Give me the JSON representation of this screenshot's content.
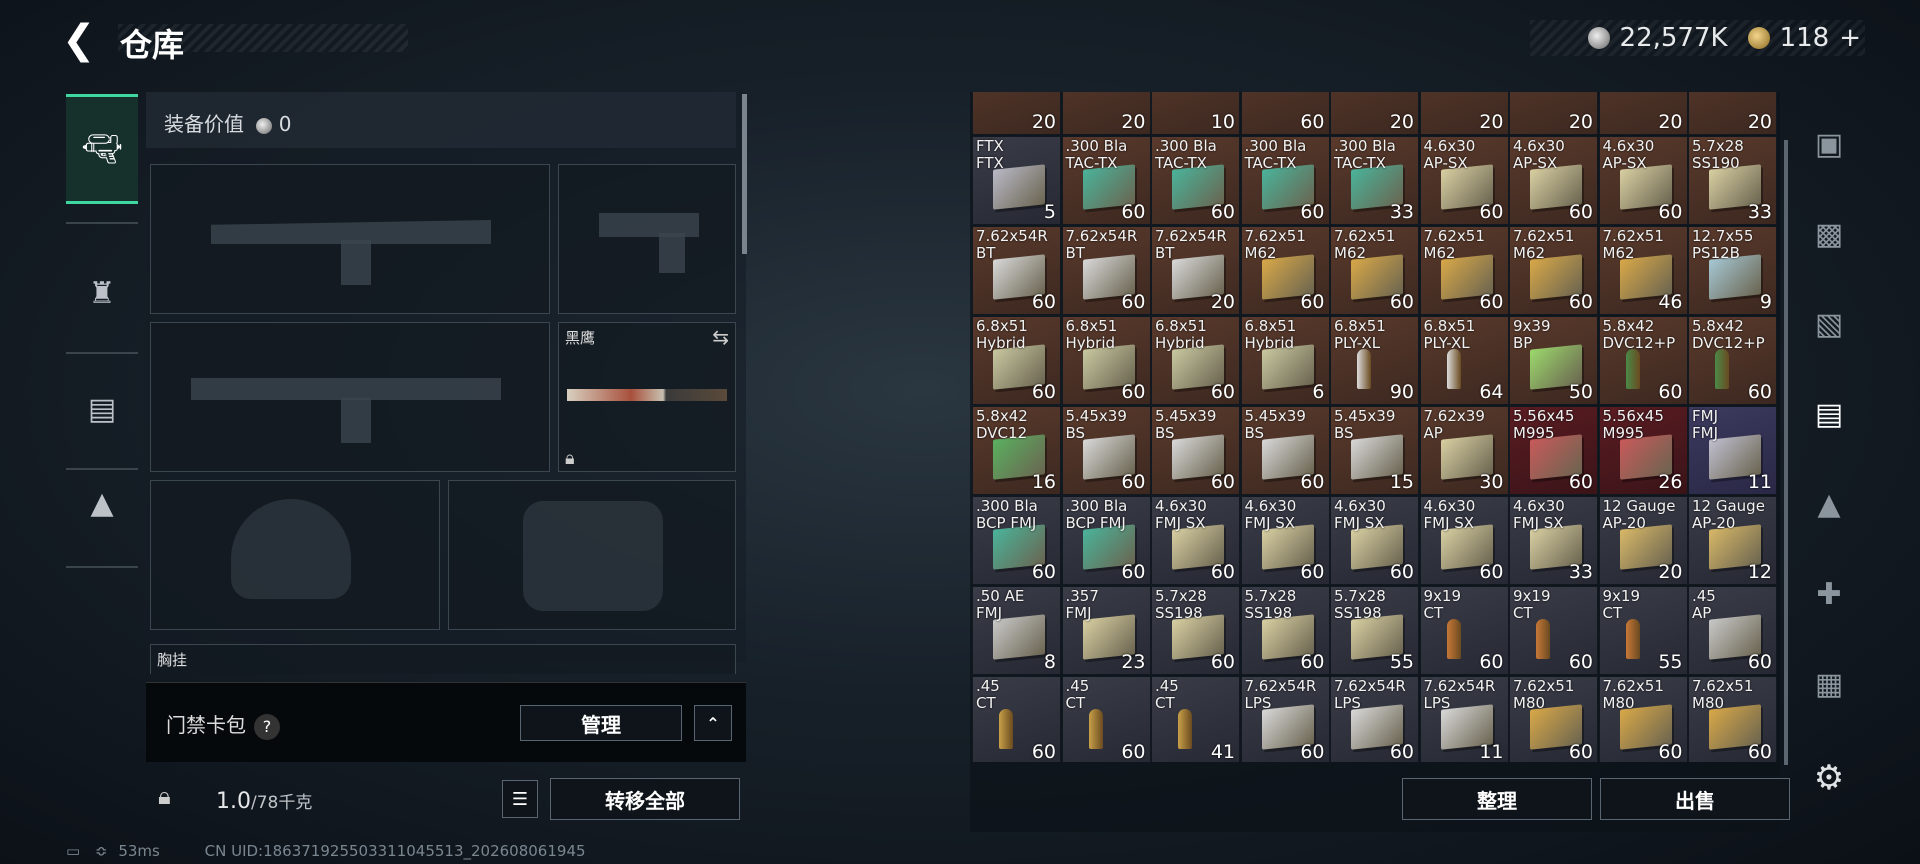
{
  "header": {
    "title": "仓库",
    "silver": "22,577K",
    "gold": "118",
    "plus": "+"
  },
  "left_rail": [
    {
      "icon": "pistol-icon",
      "glyph": "🔫"
    },
    {
      "icon": "backpack-icon",
      "glyph": "⛯"
    },
    {
      "icon": "container-icon",
      "glyph": "▤"
    },
    {
      "icon": "toolbox-icon",
      "glyph": "💼"
    }
  ],
  "equipment": {
    "value_label": "装备价值",
    "value": "0",
    "knife_label": "黑鹰",
    "chest_label": "胸挂"
  },
  "card_pack": {
    "label": "门禁卡包",
    "help": "?",
    "manage": "管理"
  },
  "weight": {
    "current": "1.0",
    "max": "/78千克",
    "transfer_all": "转移全部"
  },
  "status": {
    "ping": "53ms",
    "uid": "CN UID:186371925503311045513_202608061945"
  },
  "grid": {
    "top_counts": [
      "20",
      "20",
      "10",
      "60",
      "20",
      "20",
      "20",
      "20",
      "20"
    ],
    "rows": [
      [
        [
          "FTX\nFTX",
          "5",
          "b",
          "#b9b9c6"
        ],
        [
          ".300 Bla\nTAC-TX",
          "60",
          "r",
          "#4ab39a"
        ],
        [
          ".300 Bla\nTAC-TX",
          "60",
          "r",
          "#4ab39a"
        ],
        [
          ".300 Bla\nTAC-TX",
          "60",
          "r",
          "#4ab39a"
        ],
        [
          ".300 Bla\nTAC-TX",
          "33",
          "r",
          "#4ab39a"
        ],
        [
          "4.6x30\nAP-SX",
          "60",
          "r",
          "#d8cfa2"
        ],
        [
          "4.6x30\nAP-SX",
          "60",
          "r",
          "#d8cfa2"
        ],
        [
          "4.6x30\nAP-SX",
          "60",
          "r",
          "#d8cfa2"
        ],
        [
          "5.7x28\nSS190",
          "33",
          "r",
          "#d8cfa2"
        ]
      ],
      [
        [
          "7.62x54R\nBT",
          "60",
          "r",
          "#d8d8d8"
        ],
        [
          "7.62x54R\nBT",
          "60",
          "r",
          "#d8d8d8"
        ],
        [
          "7.62x54R\nBT",
          "20",
          "r",
          "#d8d8d8"
        ],
        [
          "7.62x51\nM62",
          "60",
          "r",
          "#d8a848"
        ],
        [
          "7.62x51\nM62",
          "60",
          "r",
          "#d8a848"
        ],
        [
          "7.62x51\nM62",
          "60",
          "r",
          "#d8a848"
        ],
        [
          "7.62x51\nM62",
          "60",
          "r",
          "#d8a848"
        ],
        [
          "7.62x51\nM62",
          "46",
          "r",
          "#d8a848"
        ],
        [
          "12.7x55\nPS12B",
          "9",
          "r",
          "#a6c8d4"
        ]
      ],
      [
        [
          "6.8x51\nHybrid",
          "60",
          "r",
          "#c8c8a0"
        ],
        [
          "6.8x51\nHybrid",
          "60",
          "r",
          "#c8c8a0"
        ],
        [
          "6.8x51\nHybrid",
          "60",
          "r",
          "#c8c8a0"
        ],
        [
          "6.8x51\nHybrid",
          "6",
          "r",
          "#c8c8a0"
        ],
        [
          "6.8x51\nPLY-XL",
          "90",
          "r",
          "#dcdcdc"
        ],
        [
          "6.8x51\nPLY-XL",
          "64",
          "r",
          "#dcdcdc"
        ],
        [
          "9x39\nBP",
          "50",
          "r",
          "#9cd86c"
        ],
        [
          "5.8x42\nDVC12+P",
          "60",
          "r",
          "#4a8a48"
        ],
        [
          "5.8x42\nDVC12+P",
          "60",
          "r",
          "#4a8a48"
        ]
      ],
      [
        [
          "5.8x42\nDVC12",
          "16",
          "r",
          "#5ab060"
        ],
        [
          "5.45x39\nBS",
          "60",
          "r",
          "#d8d8d8"
        ],
        [
          "5.45x39\nBS",
          "60",
          "r",
          "#d8d8d8"
        ],
        [
          "5.45x39\nBS",
          "60",
          "r",
          "#d8d8d8"
        ],
        [
          "5.45x39\nBS",
          "15",
          "r",
          "#d8d8d8"
        ],
        [
          "7.62x39\nAP",
          "30",
          "r",
          "#d8cfa2"
        ],
        [
          "5.56x45\nM995",
          "60",
          "rr",
          "#c85a5a"
        ],
        [
          "5.56x45\nM995",
          "26",
          "rr",
          "#c85a5a"
        ],
        [
          "FMJ\nFMJ",
          "11",
          "pp",
          "#c0c0d0"
        ]
      ],
      [
        [
          ".300 Bla\nBCP FMJ",
          "60",
          "b",
          "#4ab39a"
        ],
        [
          ".300 Bla\nBCP FMJ",
          "60",
          "b",
          "#4ab39a"
        ],
        [
          "4.6x30\nFMJ SX",
          "60",
          "b",
          "#d8cfa2"
        ],
        [
          "4.6x30\nFMJ SX",
          "60",
          "b",
          "#d8cfa2"
        ],
        [
          "4.6x30\nFMJ SX",
          "60",
          "b",
          "#d8cfa2"
        ],
        [
          "4.6x30\nFMJ SX",
          "60",
          "b",
          "#d8cfa2"
        ],
        [
          "4.6x30\nFMJ SX",
          "33",
          "b",
          "#d8cfa2"
        ],
        [
          "12 Gauge\nAP-20",
          "20",
          "b",
          "#d8b868"
        ],
        [
          "12 Gauge\nAP-20",
          "12",
          "b",
          "#d8b868"
        ]
      ],
      [
        [
          ".50 AE\nFMJ",
          "8",
          "b",
          "#c8c8c8"
        ],
        [
          ".357\nFMJ",
          "23",
          "b",
          "#d8cfa2"
        ],
        [
          "5.7x28\nSS198",
          "60",
          "b",
          "#d8cfa2"
        ],
        [
          "5.7x28\nSS198",
          "60",
          "b",
          "#d8cfa2"
        ],
        [
          "5.7x28\nSS198",
          "55",
          "b",
          "#d8cfa2"
        ],
        [
          "9x19\nCT",
          "60",
          "b",
          "#c87838"
        ],
        [
          "9x19\nCT",
          "60",
          "b",
          "#c87838"
        ],
        [
          "9x19\nCT",
          "55",
          "b",
          "#c87838"
        ],
        [
          ".45\nAP",
          "60",
          "b",
          "#c8c8c8"
        ]
      ],
      [
        [
          ".45\nCT",
          "60",
          "b",
          "#c8a048"
        ],
        [
          ".45\nCT",
          "60",
          "b",
          "#c8a048"
        ],
        [
          ".45\nCT",
          "41",
          "b",
          "#c8a048"
        ],
        [
          "7.62x54R\nLPS",
          "60",
          "b",
          "#d8d8d8"
        ],
        [
          "7.62x54R\nLPS",
          "60",
          "b",
          "#d8d8d8"
        ],
        [
          "7.62x54R\nLPS",
          "11",
          "b",
          "#d8d8d8"
        ],
        [
          "7.62x51\nM80",
          "60",
          "b",
          "#d8a848"
        ],
        [
          "7.62x51\nM80",
          "60",
          "b",
          "#d8a848"
        ],
        [
          "7.62x51\nM80",
          "60",
          "b",
          "#d8a848"
        ]
      ]
    ]
  },
  "actions": {
    "sort": "整理",
    "sell": "出售"
  },
  "side_tabs": [
    "safe-icon",
    "III-weapon-case-icon",
    "IV-ammo-case-icon",
    "IV-file-case-icon",
    "III-medical-case-icon",
    "IV-plus-case-icon",
    "III-tools-case-icon",
    "settings-icon"
  ]
}
